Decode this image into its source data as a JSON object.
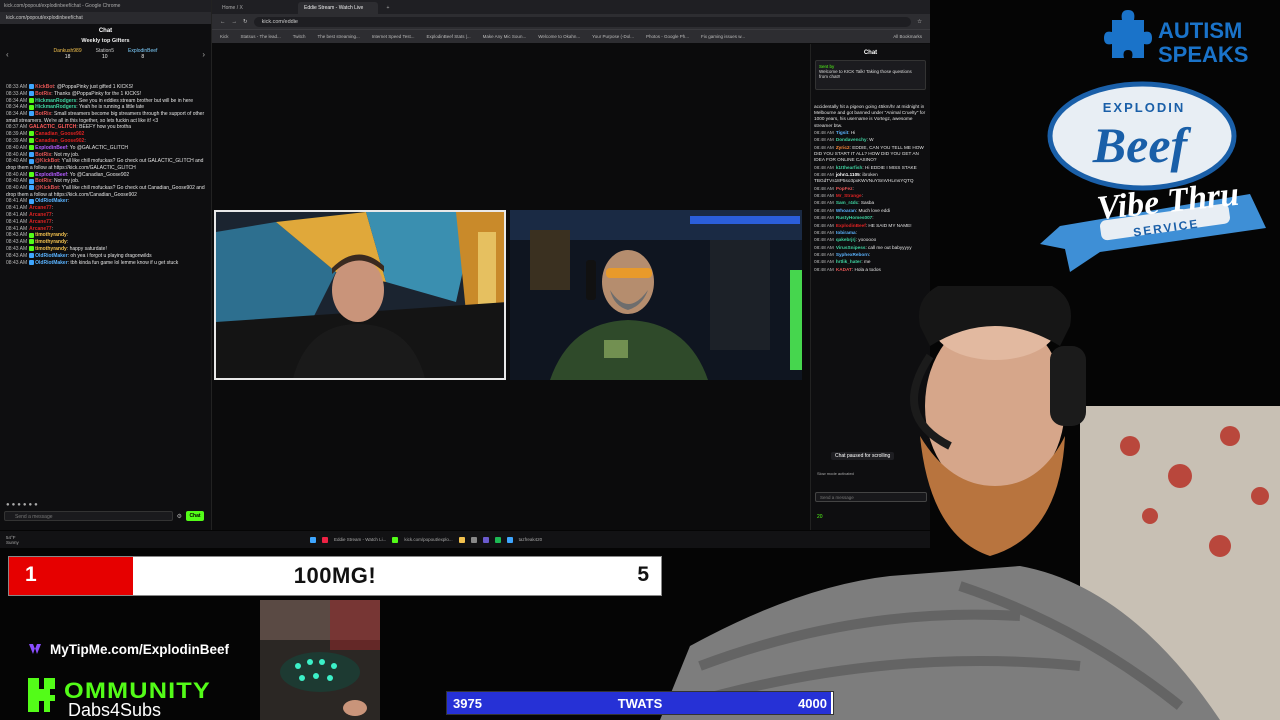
{
  "popout_chat": {
    "window_title": "kick.com/popout/explodinbeef/chat - Google Chrome",
    "url": "kick.com/popout/explodinbeef/chat",
    "header": "Chat",
    "gifts_title": "Weekly top Gifters",
    "gifters": [
      {
        "name": "Dankush989",
        "count": "18"
      },
      {
        "name": "Station5",
        "count": "10"
      },
      {
        "name": "ExplodinBeef",
        "count": "8"
      }
    ],
    "messages": [
      {
        "time": "08:33 AM",
        "user": "KickBot",
        "text": ": @PoppaPinky just gifted 1 KICKS!",
        "color": "#e35555",
        "badge": "b"
      },
      {
        "time": "08:33 AM",
        "user": "BotRix",
        "text": ": Thanks @PoppaPinky for the 1 KICKS!",
        "color": "#e35555",
        "badge": "b"
      },
      {
        "time": "08:34 AM",
        "user": "HickmanRodgers",
        "text": ": See you in eddies stream brother but will be in here",
        "color": "#3fd3a0",
        "badge": "g"
      },
      {
        "time": "08:34 AM",
        "user": "HickmanRodgers",
        "text": ": Yeah he is running a little late",
        "color": "#3fd3a0",
        "badge": "g"
      },
      {
        "time": "08:34 AM",
        "user": "BotRix",
        "text": ": Small streamers become big streamers through the support of other small streamers. We're all in this together, so lets fuckin act like it! <3",
        "color": "#e35555",
        "badge": "b"
      },
      {
        "time": "08:37 AM",
        "user": "GALACTIC_GLITCH",
        "text": ": BEEFY how you brotha",
        "color": "#ff5a5a",
        "badge": ""
      },
      {
        "time": "08:39 AM",
        "user": "Canadian_Goose902",
        "text": "",
        "color": "#d22",
        "badge": "g"
      },
      {
        "time": "08:39 AM",
        "user": "Canadian_Goose902",
        "text": ":",
        "color": "#d22",
        "badge": "g"
      },
      {
        "time": "08:40 AM",
        "user": "ExplodinBeef",
        "text": ": Yo @GALACTIC_GLITCH",
        "color": "#b45cff",
        "badge": "g"
      },
      {
        "time": "08:40 AM",
        "user": "BotRix",
        "text": ": Not my job.",
        "color": "#e35555",
        "badge": "b"
      },
      {
        "time": "08:40 AM",
        "user": "@KickBot",
        "text": ": Y'all like chill mofuckas? Go check out GALACTIC_GLITCH and drop them a follow at https://kick.com/GALACTIC_GLITCH",
        "color": "#e35555",
        "badge": "b"
      },
      {
        "time": "08:40 AM",
        "user": "ExplodinBeef",
        "text": ": Yo @Canadian_Goose902",
        "color": "#b45cff",
        "badge": "g"
      },
      {
        "time": "08:40 AM",
        "user": "BotRix",
        "text": ": Not my job.",
        "color": "#e35555",
        "badge": "b"
      },
      {
        "time": "08:40 AM",
        "user": "@KickBot",
        "text": ": Y'all like chill mofuckas? Go check out Canadian_Goose902 and drop them a follow at https://kick.com/Canadian_Goose902",
        "color": "#e35555",
        "badge": "b"
      },
      {
        "time": "08:41 AM",
        "user": "OldRiotMaker",
        "text": ":",
        "color": "#5ab3ff",
        "badge": "b"
      },
      {
        "time": "08:41 AM",
        "user": "Arcane77",
        "text": ":",
        "color": "#d22",
        "badge": ""
      },
      {
        "time": "08:41 AM",
        "user": "Arcane77",
        "text": ":",
        "color": "#d22",
        "badge": ""
      },
      {
        "time": "08:41 AM",
        "user": "Arcane77",
        "text": ":",
        "color": "#d22",
        "badge": ""
      },
      {
        "time": "08:41 AM",
        "user": "Arcane77",
        "text": ":",
        "color": "#d22",
        "badge": ""
      },
      {
        "time": "08:43 AM",
        "user": "timothyrandy",
        "text": ":",
        "color": "#f2c14e",
        "badge": "g"
      },
      {
        "time": "08:43 AM",
        "user": "timothyrandy",
        "text": ":",
        "color": "#f2c14e",
        "badge": "g"
      },
      {
        "time": "08:43 AM",
        "user": "timothyrandy",
        "text": ": happy saturdate!",
        "color": "#f2c14e",
        "badge": "g"
      },
      {
        "time": "08:43 AM",
        "user": "OldRiotMaker",
        "text": ": oh yea i forgot u playing dragonwilds",
        "color": "#5ab3ff",
        "badge": "b"
      },
      {
        "time": "08:43 AM",
        "user": "OldRiotMaker",
        "text": ": tbh kinda fun game lol lemme know if u get stuck",
        "color": "#5ab3ff",
        "badge": "b"
      }
    ],
    "input_placeholder": "Send a message",
    "chat_button": "Chat"
  },
  "browser": {
    "tabs": [
      "Home / X",
      "Eddie Stream - Watch Live",
      "+"
    ],
    "url": "kick.com/eddie",
    "bookmarks": [
      "Kick",
      "Statsus - The lead...",
      "Twitch",
      "The best streaming...",
      "Internet Speed Test...",
      "ExplodinBeef Stats |...",
      "Make Any Mic Soun...",
      "Welcome to Okahn...",
      "Your Purpose (-Dol...",
      "Photos - Google Ph...",
      "Fix gaming issues w..."
    ],
    "all_bookmarks": "All Bookmarks"
  },
  "kick_chat": {
    "header": "Chat",
    "pinned_by": "Sent by",
    "pinned_text": "Welcome to KICK Talk! Taking those questions from chat!!",
    "messages": [
      {
        "time": "",
        "user": "",
        "text": "accidentally hit a pigeon going 45km/hr at midnight in Melbourne and got banned under \"Animal Cruelty\" for 1000 years, his username is Vortegz, awesome streamer btw.",
        "color": "#fff"
      },
      {
        "time": "08:48 AM",
        "user": "Tigsit",
        "text": ": Hi",
        "color": "#5ab3ff"
      },
      {
        "time": "08:48 AM",
        "user": "Dondavenchy",
        "text": ": W",
        "color": "#3fd3a0"
      },
      {
        "time": "08:48 AM",
        "user": "Zyric2",
        "text": ": EDDIE, CAN YOU TELL ME HOW DID YOU START IT ALL? HOW DID YOU GET AN IDEA FOR ONLINE CASINO?",
        "color": "#ff8c3b"
      },
      {
        "time": "08:48 AM",
        "user": "k1tthearfish",
        "text": ": Hi EDDIE I MISS STAKE",
        "color": "#3fd3a0"
      },
      {
        "time": "08:48 AM",
        "user": "john1.1105",
        "text": ": ibroken TBGdTVs18P5so3pxKWVNuYSmVHLmsYQTQ",
        "color": "#fff"
      },
      {
        "time": "08:48 AM",
        "user": "PopFez",
        "text": ":",
        "color": "#e35555"
      },
      {
        "time": "08:48 AM",
        "user": "Mr_Strange",
        "text": ":",
        "color": "#d22"
      },
      {
        "time": "08:48 AM",
        "user": "Sam_r4dc",
        "text": ": Sasba",
        "color": "#3fd3a0"
      },
      {
        "time": "08:48 AM",
        "user": "Whoaran",
        "text": ": Much love eddi",
        "color": "#5ab3ff"
      },
      {
        "time": "08:48 AM",
        "user": "RustyHomes007",
        "text": ":",
        "color": "#3fd3a0"
      },
      {
        "time": "08:48 AM",
        "user": "ExplodinBeef",
        "text": ": HE SAID MY NAME!",
        "color": "#d22"
      },
      {
        "time": "08:48 AM",
        "user": "tobirama",
        "text": ":",
        "color": "#5ab3ff"
      },
      {
        "time": "08:48 AM",
        "user": "qakebrjrj",
        "text": ": yoooooo",
        "color": "#3fd3a0"
      },
      {
        "time": "08:48 AM",
        "user": "VirusSnipess",
        "text": ": call me out babyyyyy",
        "color": "#3fd3a0"
      },
      {
        "time": "08:48 AM",
        "user": "SyphexReborn",
        "text": ":",
        "color": "#5ab3ff"
      },
      {
        "time": "08:48 AM",
        "user": "hrtlik_hater",
        "text": ": me",
        "color": "#3fd3a0"
      },
      {
        "time": "08:48 AM",
        "user": "KADAT",
        "text": ": Hola a todos",
        "color": "#e35555"
      }
    ],
    "paused": "Chat paused for scrolling",
    "slow_mode": "Slow mode activated",
    "send_placeholder": "Send a message",
    "viewer_count": "20"
  },
  "taskbar": {
    "weather_temp": "54°F",
    "weather_desc": "Sunny",
    "apps": [
      "Eddie Stream - Watch Li...",
      "kick.com/popout/explo...",
      "tazfreak420"
    ]
  },
  "overlay": {
    "score": {
      "left": "1",
      "label": "100MG!",
      "right": "5",
      "fill_fraction": 0.19
    },
    "tipme": "MyTipMe.com/ExplodinBeef",
    "kommunity_word": "OMMUNITY",
    "kommunity_sub": "Dabs4Subs",
    "goal": {
      "current": "3975",
      "label": "TWATS",
      "target": "4000",
      "fill_fraction": 0.994
    },
    "autism_line1": "AUTISM",
    "autism_line2": "SPEAKS",
    "vibe_top": "EXPLODIN",
    "vibe_beef": "Beef",
    "vibe_thru": "Vibe Thru",
    "vibe_service": "SERVICE"
  },
  "colors": {
    "kick_green": "#53fc18",
    "score_red": "#e60000",
    "goal_blue": "#2631d6",
    "autism_blue": "#1a73c9"
  }
}
